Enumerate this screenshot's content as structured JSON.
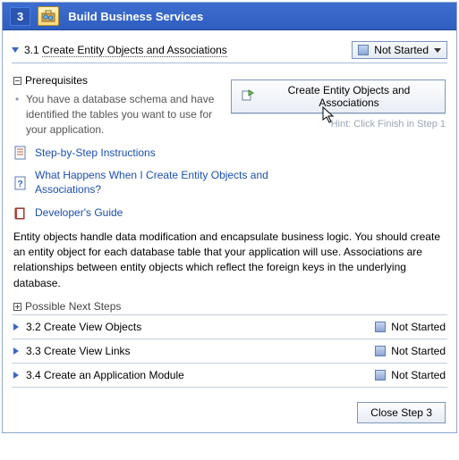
{
  "header": {
    "number": "3",
    "title": "Build Business Services"
  },
  "section": {
    "number": "3.1",
    "title": "Create Entity Objects and Associations",
    "status": "Not Started"
  },
  "prereq": {
    "heading": "Prerequisites",
    "text": "You have a database schema and have identified the tables you want to use for your application."
  },
  "main_button": "Create Entity Objects and Associations",
  "hint": "Hint: Click Finish in Step 1",
  "links": {
    "step_by_step": "Step-by-Step Instructions",
    "what_happens": "What Happens When I Create Entity Objects and Associations?",
    "dev_guide": "Developer's Guide"
  },
  "description": "Entity objects handle data modification and encapsulate business logic. You should create an entity object for each database table that your application will use. Associations are relationships between entity objects which reflect the foreign keys in the underlying database.",
  "possible_next": "Possible Next Steps",
  "subs": [
    {
      "num": "3.2",
      "title": "Create View Objects",
      "status": "Not Started"
    },
    {
      "num": "3.3",
      "title": "Create View Links",
      "status": "Not Started"
    },
    {
      "num": "3.4",
      "title": "Create an Application Module",
      "status": "Not Started"
    }
  ],
  "footer": {
    "close": "Close Step 3"
  }
}
